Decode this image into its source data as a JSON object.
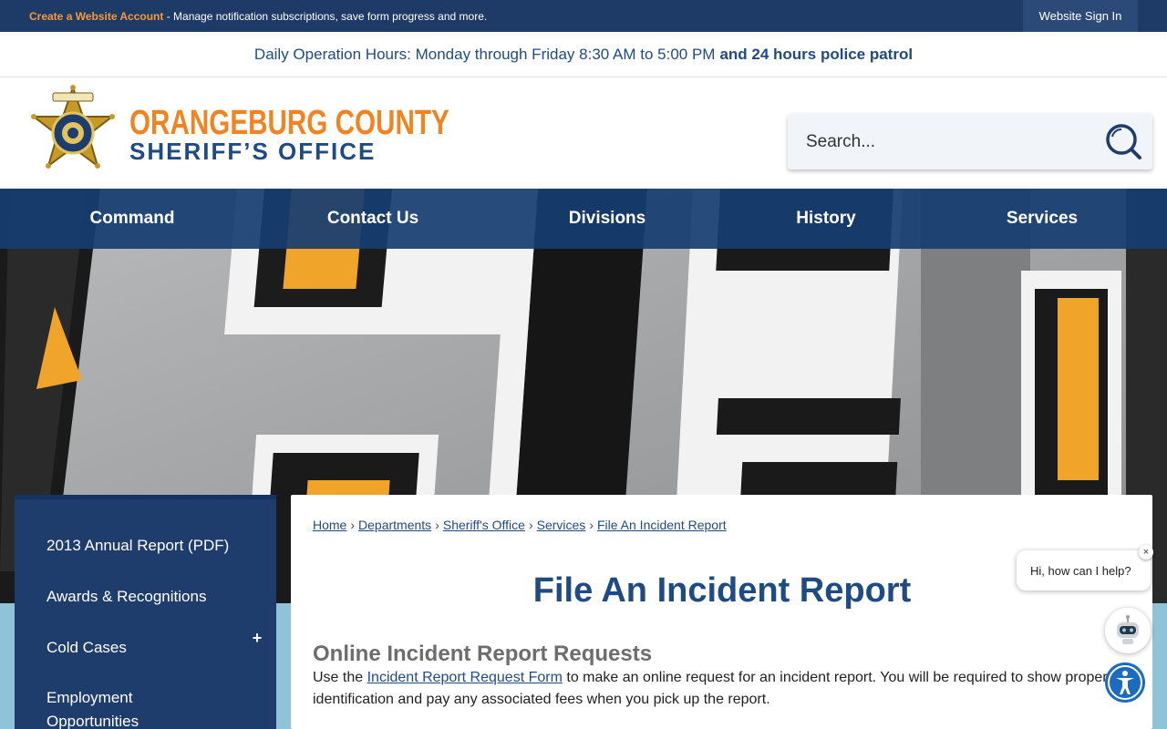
{
  "topbar": {
    "create_account": "Create a Website Account",
    "create_desc": " - Manage notification subscriptions, save form progress and more.",
    "signin": "Website Sign In"
  },
  "hours": {
    "regular": "Daily Operation Hours: Monday through Friday 8:30 AM to 5:00 PM",
    "bold": "and 24 hours police patrol"
  },
  "logo": {
    "line1": "ORANGEBURG COUNTY",
    "line2": "SHERIFF’S OFFICE",
    "badge_icon": "sheriff-star-badge"
  },
  "search": {
    "placeholder": "Search..."
  },
  "nav": {
    "items": [
      {
        "label": "Command"
      },
      {
        "label": "Contact Us"
      },
      {
        "label": "Divisions"
      },
      {
        "label": "History"
      },
      {
        "label": "Services"
      }
    ]
  },
  "sidebar": {
    "items": [
      {
        "label": "2013 Annual Report (PDF)"
      },
      {
        "label": "Awards & Recognitions"
      },
      {
        "label": "Cold Cases",
        "expand": "+"
      },
      {
        "label": "Employment Opportunities"
      }
    ]
  },
  "breadcrumb": {
    "items": [
      "Home",
      "Departments",
      "Sheriff's Office",
      "Services",
      "File An Incident Report"
    ],
    "separator": "›"
  },
  "main": {
    "title": "File An Incident Report",
    "section_title": "Online Incident Report Requests",
    "para_before": "Use the ",
    "para_link": "Incident Report Request Form",
    "para_after": " to make an online request for an incident report. You will be required to show proper identification and pay any associated fees when you pick up the report."
  },
  "chat": {
    "greeting": "Hi, how can I help?",
    "close": "×"
  },
  "colors": {
    "navy": "#1e3a66",
    "brand_blue": "#1f4b84",
    "brand_orange": "#f08422",
    "accent_link": "#f59a3a"
  }
}
